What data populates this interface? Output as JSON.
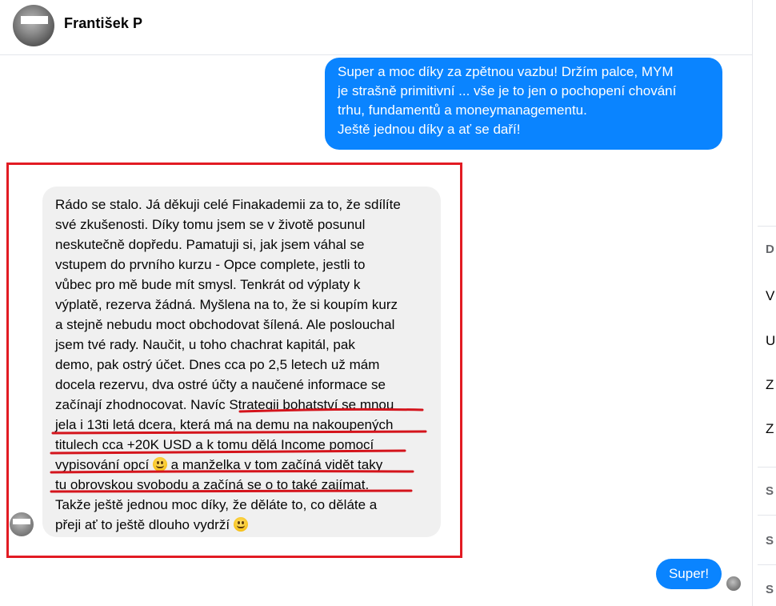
{
  "header": {
    "contact_name": "František P"
  },
  "right_panel": {
    "items": [
      "D",
      "V",
      "U",
      "Z",
      "Z",
      "S",
      "S",
      "S"
    ]
  },
  "messages": {
    "outgoing_1": {
      "lines": [
        "Super a moc díky za zpětnou vazbu! Držím palce, MYM",
        "je strašně primitivní ... vše je to jen o pochopení chování",
        "trhu, fundamentů a moneymanagementu.",
        "Ještě jednou díky a ať se daří!"
      ]
    },
    "incoming_1": {
      "lines": [
        "Rádo se stalo. Já děkuji celé Finakademii za to, že sdílíte",
        "své zkušenosti. Díky tomu jsem se v životě posunul",
        "neskutečně dopředu. Pamatuji si, jak jsem váhal se",
        "vstupem do prvního kurzu - Opce complete, jestli to",
        "vůbec pro mě bude mít smysl. Tenkrát od výplaty k",
        "výplatě, rezerva žádná. Myšlena na to, že si koupím kurz",
        "a stejně nebudu moct obchodovat šílená. Ale poslouchal",
        "jsem tvé rady. Naučit, u toho chachrat kapitál, pak",
        "demo, pak ostrý účet. Dnes cca po 2,5 letech už mám",
        "docela rezervu, dva ostré účty a naučené informace se",
        "začínají zhodnocovat. Navíc Strategii bohatství se mnou",
        "jela i 13ti letá dcera, která má na demu na nakoupených",
        "titulech cca +20K USD a k tomu dělá Income pomocí",
        "vypisování opcí",
        "a manželka v tom začíná vidět taky",
        "tu obrovskou svobodu a začíná se o to také zajímat.",
        "Takže ještě jednou moc díky, že děláte to, co děláte a",
        "přeji ať to ještě dlouho vydrží"
      ],
      "emoji_1": "grinning-face",
      "emoji_2": "winking-tongue-face"
    },
    "outgoing_2": {
      "text": "Super!"
    }
  },
  "annotation": {
    "box_color": "#e21b23",
    "underline_color": "#d4141c"
  },
  "colors": {
    "outgoing_bubble": "#0a84ff",
    "incoming_bubble": "#f0f0f0"
  }
}
